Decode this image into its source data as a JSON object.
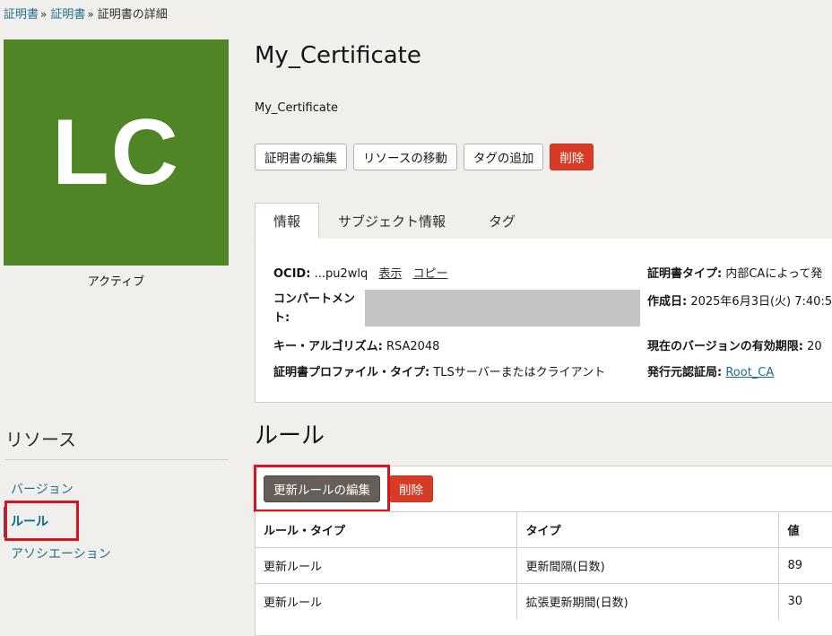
{
  "breadcrumb": [
    {
      "label": "証明書",
      "link": true
    },
    {
      "label": "証明書",
      "link": true
    },
    {
      "label": "証明書の詳細",
      "link": false
    }
  ],
  "breadcrumb_separator": "»",
  "avatar": {
    "initials": "LC",
    "color": "#4f8525"
  },
  "status": "アクティブ",
  "title": "My_Certificate",
  "subtitle": "My_Certificate",
  "actions": {
    "edit": "証明書の編集",
    "move": "リソースの移動",
    "add_tags": "タグの追加",
    "delete": "削除"
  },
  "tabs": [
    {
      "label": "情報",
      "active": true
    },
    {
      "label": "サブジェクト情報",
      "active": false
    },
    {
      "label": "タグ",
      "active": false
    }
  ],
  "info": {
    "ocid_label": "OCID:",
    "ocid_value": "...pu2wlq",
    "ocid_show": "表示",
    "ocid_copy": "コピー",
    "compartment_label": "コンパートメント:",
    "key_algorithm_label": "キー・アルゴリズム:",
    "key_algorithm_value": "RSA2048",
    "profile_type_label": "証明書プロファイル・タイプ:",
    "profile_type_value": "TLSサーバーまたはクライアント",
    "cert_type_label": "証明書タイプ:",
    "cert_type_value": "内部CAによって発",
    "created_label": "作成日:",
    "created_value": "2025年6月3日(火) 7:40:5",
    "validity_label": "現在のバージョンの有効期限:",
    "validity_value": "20",
    "issuer_label": "発行元認証局:",
    "issuer_value": "Root_CA"
  },
  "resources": {
    "title": "リソース",
    "items": [
      {
        "label": "バージョン",
        "active": false
      },
      {
        "label": "ルール",
        "active": true
      },
      {
        "label": "アソシエーション",
        "active": false
      }
    ]
  },
  "rules": {
    "title": "ルール",
    "edit_button": "更新ルールの編集",
    "delete_button": "削除",
    "columns": [
      "ルール・タイプ",
      "タイプ",
      "値"
    ],
    "rows": [
      [
        "更新ルール",
        "更新間隔(日数)",
        "89"
      ],
      [
        "更新ルール",
        "拡張更新期間(日数)",
        "30"
      ]
    ]
  },
  "colors": {
    "accent": "#1f6f8b",
    "danger": "#d63b25",
    "highlight": "#d8141f"
  }
}
